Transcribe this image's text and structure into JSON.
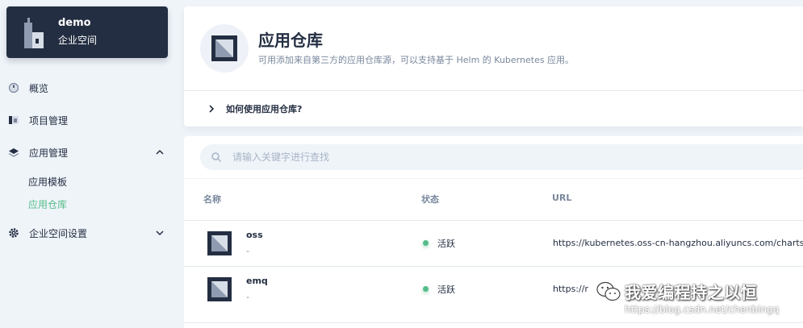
{
  "workspace": {
    "name": "demo",
    "subtitle": "企业空间"
  },
  "sidebar": {
    "items": [
      {
        "label": "概览",
        "icon": "dashboard-icon"
      },
      {
        "label": "项目管理",
        "icon": "project-icon"
      },
      {
        "label": "应用管理",
        "icon": "layers-icon",
        "expanded": true,
        "children": [
          {
            "label": "应用模板",
            "active": false
          },
          {
            "label": "应用仓库",
            "active": true
          }
        ]
      },
      {
        "label": "企业空间设置",
        "icon": "gear-icon",
        "expanded": false
      }
    ]
  },
  "header": {
    "title": "应用仓库",
    "description": "可用添加来自第三方的应用仓库源，可以支持基于 Helm 的 Kubernetes 应用。",
    "howto": "如何使用应用仓库?"
  },
  "search": {
    "placeholder": "请输入关键字进行查找"
  },
  "table": {
    "columns": [
      "名称",
      "状态",
      "URL"
    ],
    "rows": [
      {
        "name": "oss",
        "description": "-",
        "status": "活跃",
        "url": "https://kubernetes.oss-cn-hangzhou.aliyuncs.com/charts"
      },
      {
        "name": "emq",
        "description": "-",
        "status": "活跃",
        "url": "https://r"
      }
    ]
  },
  "watermark": {
    "title": "我爱编程持之以恒",
    "url": "https://blog.csdn.net/chenbingq"
  },
  "colors": {
    "accent": "#55bc8a",
    "dark": "#242e42",
    "muted": "#79879c",
    "background": "#eff4f9"
  }
}
